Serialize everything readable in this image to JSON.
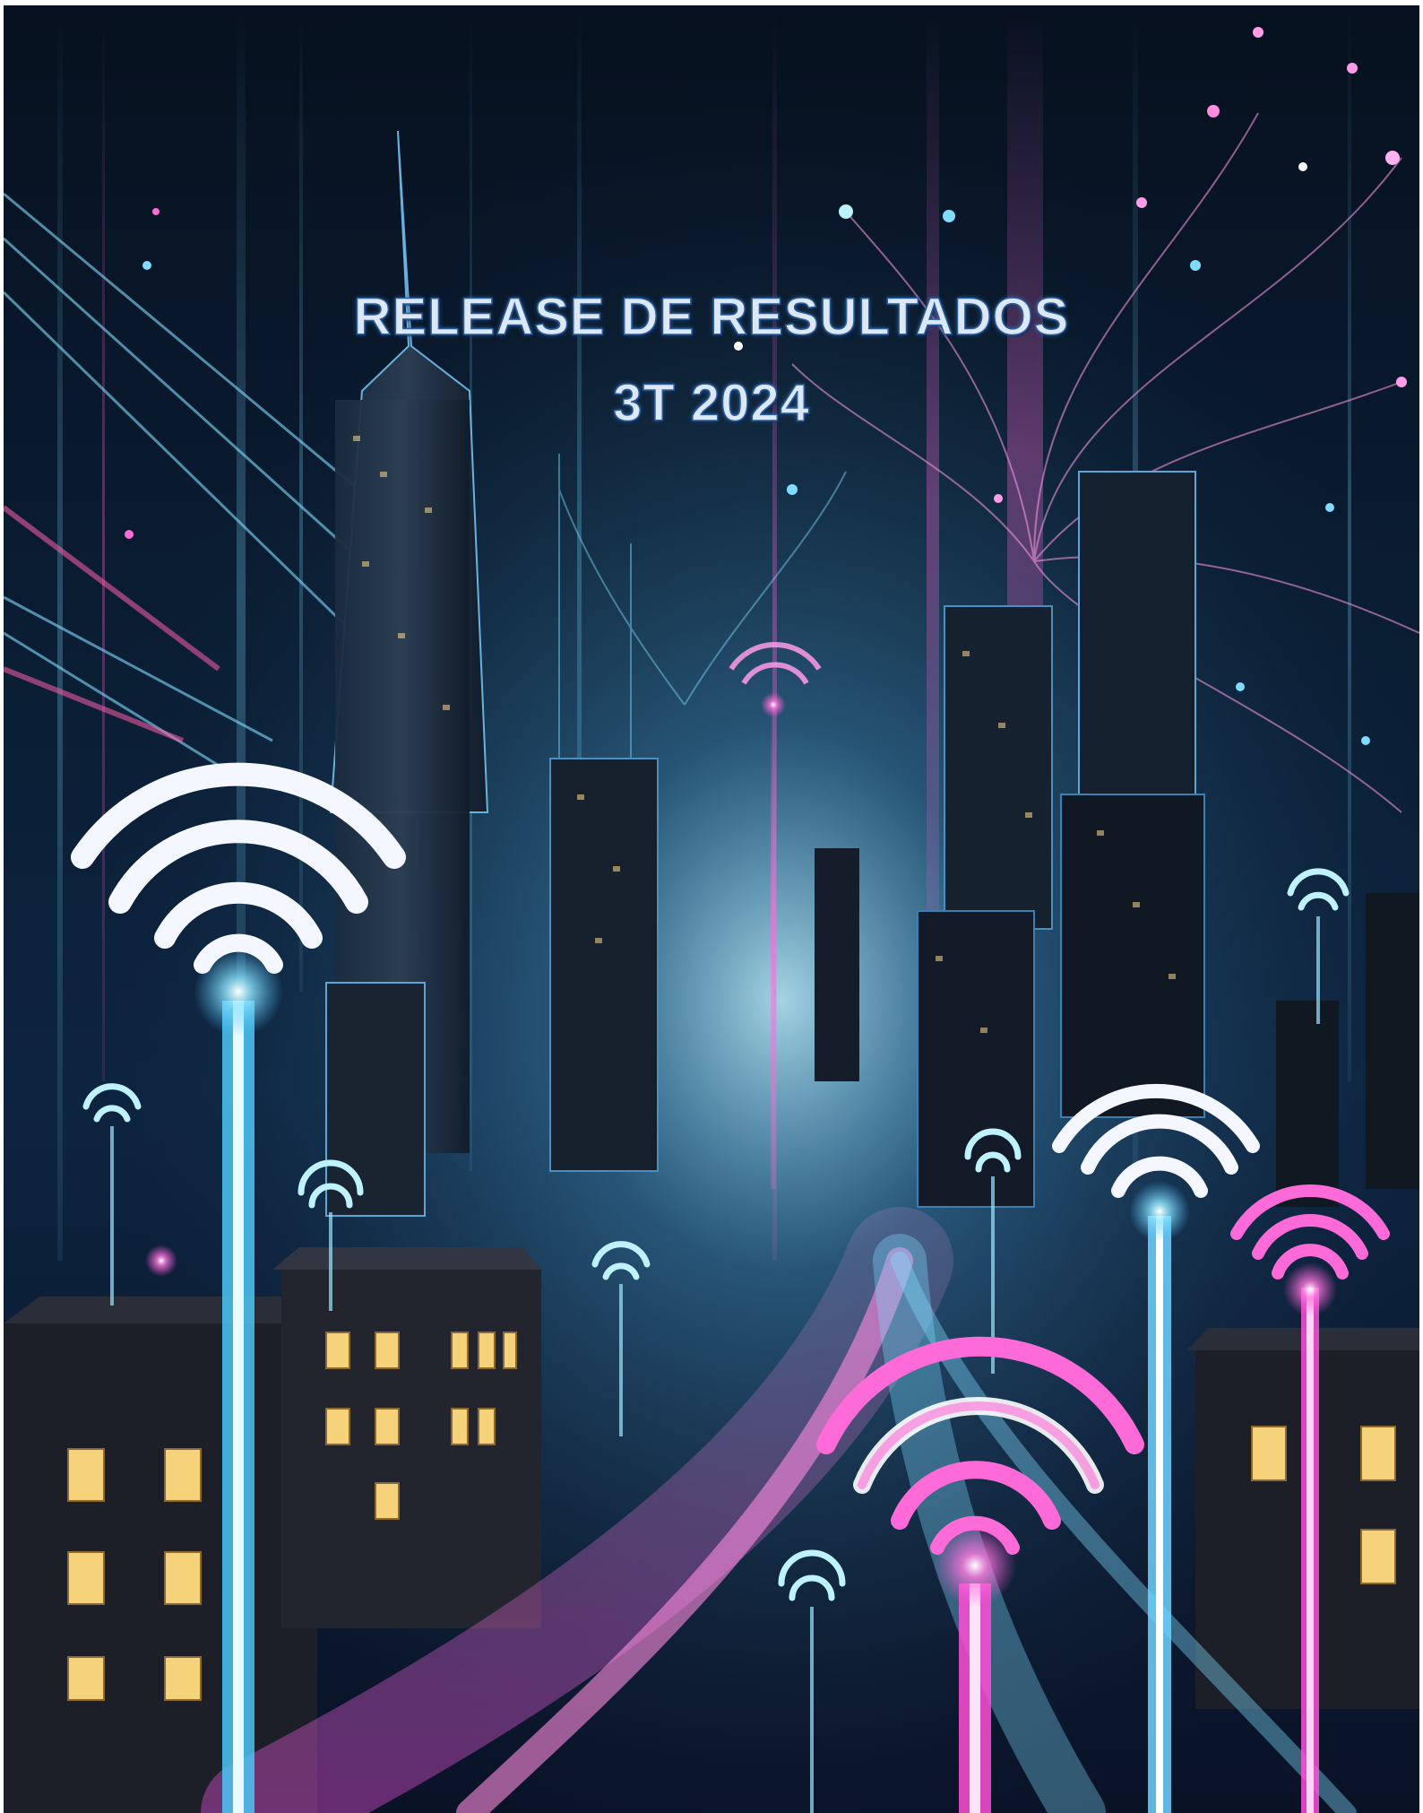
{
  "cover": {
    "title": "RELEASE DE RESULTADOS",
    "period": "3T 2024"
  },
  "palette": {
    "background": "#0a1d33",
    "neon_cyan": "#6fd3ff",
    "neon_pink": "#ff4fd8",
    "title_text": "#dde8f6",
    "title_outline": "#2a5d9a"
  },
  "illustration": {
    "subject": "futuristic night city skyline with glowing wifi antennas and light streams"
  }
}
